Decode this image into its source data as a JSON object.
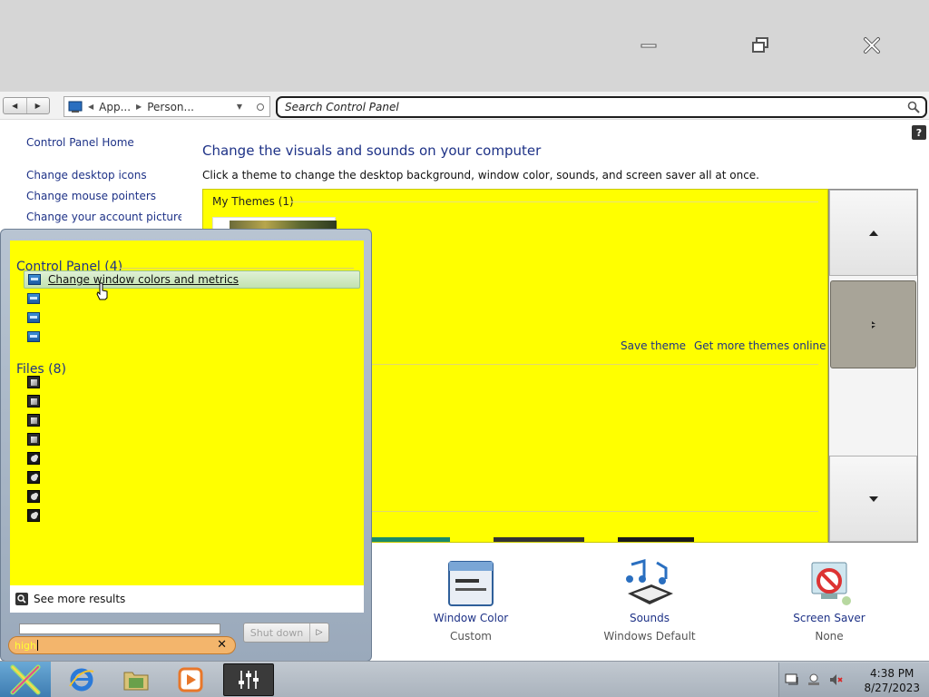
{
  "address": {
    "crumbs": [
      "App...",
      "Person..."
    ],
    "search_placeholder": "Search Control Panel"
  },
  "help_label": "?",
  "leftnav": {
    "home": "Control Panel Home",
    "items": [
      "Change desktop icons",
      "Change mouse pointers",
      "Change your account picture"
    ]
  },
  "main": {
    "title": "Change the visuals and sounds on your computer",
    "description": "Click a theme to change the desktop background, window color, sounds, and screen saver all at once.",
    "my_themes_label": "My Themes (1)",
    "save_theme": "Save theme",
    "get_more_themes": "Get more themes online",
    "bottom": [
      {
        "name": "Window Color",
        "value": "Custom",
        "icon": "window-color-icon"
      },
      {
        "name": "Sounds",
        "value": "Windows Default",
        "icon": "sounds-icon"
      },
      {
        "name": "Screen Saver",
        "value": "None",
        "icon": "screen-saver-icon"
      }
    ]
  },
  "start_menu": {
    "cp_header": "Control Panel (4)",
    "cp_first_result": "Change window colors and metrics",
    "files_header": "Files (8)",
    "see_more": "See more results",
    "shutdown": "Shut down",
    "search_value": "high"
  },
  "taskbar": {
    "time": "4:38 PM",
    "date": "8/27/2023"
  },
  "colors": {
    "results_bg": "#ffff00",
    "link": "#1e3287",
    "search_box": "#f3b56c"
  }
}
